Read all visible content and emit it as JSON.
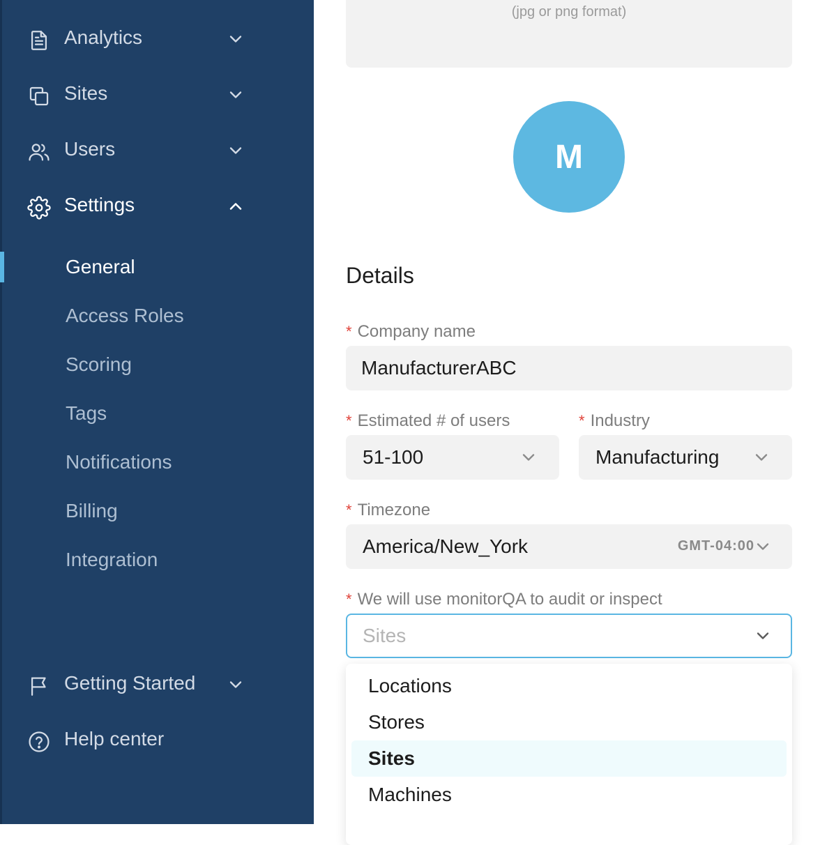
{
  "sidebar": {
    "items": [
      {
        "label": "Analytics",
        "icon": "document-icon"
      },
      {
        "label": "Sites",
        "icon": "copy-icon"
      },
      {
        "label": "Users",
        "icon": "users-icon"
      },
      {
        "label": "Settings",
        "icon": "gear-icon"
      }
    ],
    "settings_sub": [
      "General",
      "Access Roles",
      "Scoring",
      "Tags",
      "Notifications",
      "Billing",
      "Integration"
    ],
    "bottom": [
      {
        "label": "Getting Started",
        "icon": "flag-icon"
      },
      {
        "label": "Help center",
        "icon": "help-circle-icon"
      }
    ]
  },
  "main": {
    "upload_hint": "(jpg or png format)",
    "avatar_letter": "M",
    "section_title": "Details",
    "company_label": "Company name",
    "company_value": "ManufacturerABC",
    "users_label": "Estimated # of users",
    "users_value": "51-100",
    "industry_label": "Industry",
    "industry_value": "Manufacturing",
    "timezone_label": "Timezone",
    "timezone_value": "America/New_York",
    "timezone_offset": "GMT-04:00",
    "audit_label": "We will use monitorQA to audit or inspect",
    "audit_placeholder": "Sites",
    "options": [
      "Locations",
      "Stores",
      "Sites",
      "Machines"
    ]
  },
  "colors": {
    "sidebar_bg": "#1f4066",
    "accent": "#5ab6e3",
    "required": "#e0433a"
  }
}
